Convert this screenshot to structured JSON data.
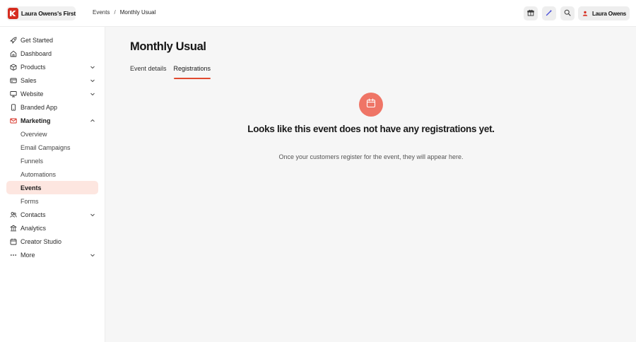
{
  "brand": {
    "name": "Laura Owens's First",
    "logo_icon": "kajabi-k-logo",
    "logo_color": "#d62d20"
  },
  "breadcrumb": {
    "parent": "Events",
    "separator": "/",
    "current": "Monthly Usual"
  },
  "top_actions": {
    "icons": [
      "gift-icon",
      "magic-wand-icon",
      "search-icon"
    ]
  },
  "user": {
    "name": "Laura Owens",
    "avatar_icon": "user-icon"
  },
  "sidebar": {
    "items": [
      {
        "label": "Get Started",
        "icon": "rocket-icon"
      },
      {
        "label": "Dashboard",
        "icon": "home-icon"
      },
      {
        "label": "Products",
        "icon": "box-icon",
        "chevron": "down"
      },
      {
        "label": "Sales",
        "icon": "credit-card-icon",
        "chevron": "down"
      },
      {
        "label": "Website",
        "icon": "monitor-icon",
        "chevron": "down"
      },
      {
        "label": "Branded App",
        "icon": "phone-icon"
      },
      {
        "label": "Marketing",
        "icon": "mail-icon",
        "chevron": "up",
        "expanded": true
      },
      {
        "label": "Overview",
        "sub": true
      },
      {
        "label": "Email Campaigns",
        "sub": true
      },
      {
        "label": "Funnels",
        "sub": true
      },
      {
        "label": "Automations",
        "sub": true
      },
      {
        "label": "Events",
        "sub": true,
        "active": true
      },
      {
        "label": "Forms",
        "sub": true
      },
      {
        "label": "Contacts",
        "icon": "contacts-icon",
        "chevron": "down"
      },
      {
        "label": "Analytics",
        "icon": "bank-icon"
      },
      {
        "label": "Creator Studio",
        "icon": "calendar-icon"
      },
      {
        "label": "More",
        "icon": "ellipsis-icon",
        "chevron": "down"
      }
    ]
  },
  "main": {
    "title": "Monthly Usual",
    "tabs": [
      {
        "label": "Event details",
        "active": false
      },
      {
        "label": "Registrations",
        "active": true
      }
    ],
    "empty_state": {
      "icon": "calendar-icon",
      "title": "Looks like this event does not have any registrations yet.",
      "subtitle": "Once your customers register for the event, they will appear here."
    }
  },
  "colors": {
    "accent": "#e14a2f",
    "active_bg": "#fde6e0",
    "empty_icon_bg": "#ef7566"
  }
}
